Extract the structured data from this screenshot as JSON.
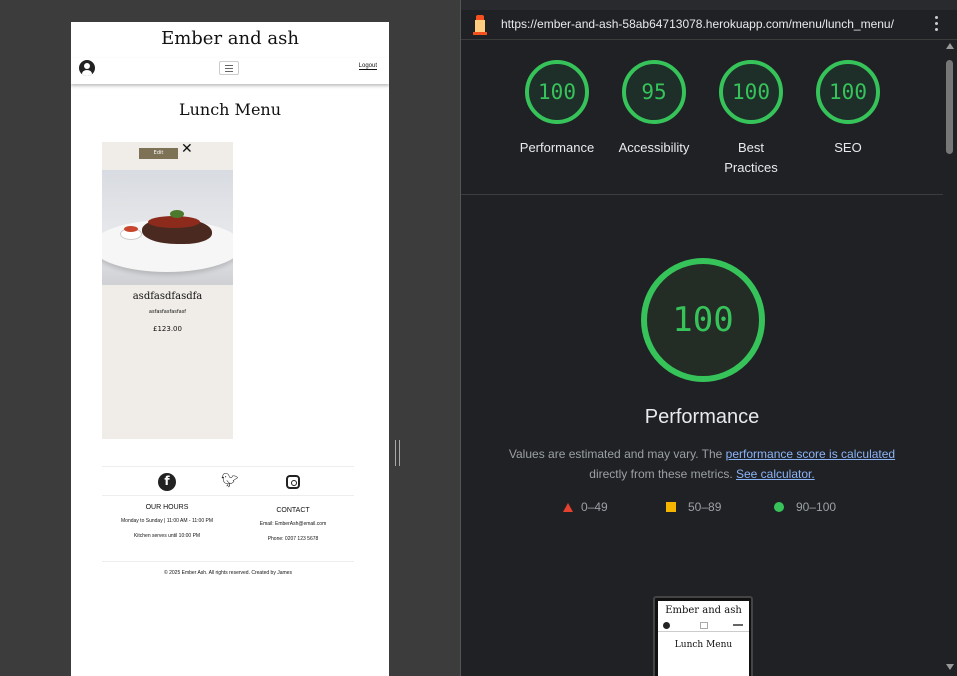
{
  "site": {
    "title": "Ember and ash",
    "logout_label": "Logout",
    "menu_heading": "Lunch Menu",
    "card": {
      "tag": "Edit",
      "close": "✕",
      "name": "asdfasdfasdfa",
      "description": "asfasfasfasfasf",
      "price": "£123.00"
    },
    "footer": {
      "hours_heading": "OUR HOURS",
      "hours_line1": "Monday to Sunday | 11:00 AM - 11:00 PM",
      "hours_line2": "Kitchen serves until 10:00 PM",
      "contact_heading": "CONTACT",
      "contact_email": "Email: EmberAsh@email.com",
      "contact_phone": "Phone: 0207 123 5678",
      "copyright": "© 2025 Ember Ash. All rights reserved. Created by James"
    }
  },
  "lighthouse": {
    "url": "https://ember-and-ash-58ab64713078.herokuapp.com/menu/lunch_menu/",
    "scores": [
      {
        "label": "Performance",
        "value": "100"
      },
      {
        "label": "Accessibility",
        "value": "95"
      },
      {
        "label": "Best Practices",
        "value": "100"
      },
      {
        "label": "SEO",
        "value": "100"
      }
    ],
    "main_score": "100",
    "main_title": "Performance",
    "desc_prefix": "Values are estimated and may vary. The ",
    "desc_link1": "performance score is calculated",
    "desc_mid": " directly from these metrics. ",
    "desc_link2": "See calculator.",
    "legend": {
      "fail": "0–49",
      "average": "50–89",
      "pass": "90–100"
    },
    "thumb": {
      "title": "Ember and ash",
      "heading": "Lunch Menu"
    },
    "colors": {
      "pass": "#36c35a",
      "average": "#f4b400",
      "fail": "#e5412e"
    }
  }
}
